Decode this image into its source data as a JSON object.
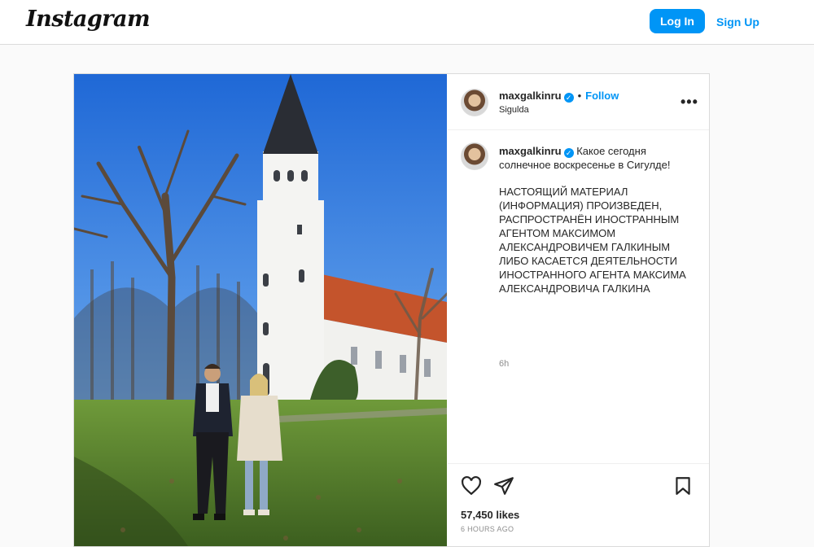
{
  "header": {
    "logo": "Instagram",
    "login_label": "Log In",
    "signup_label": "Sign Up"
  },
  "post": {
    "username": "maxgalkinru",
    "verified_mark": "✓",
    "separator": "•",
    "follow_label": "Follow",
    "location": "Sigulda",
    "more_label": "•••",
    "caption_intro": "Какое сегодня солнечное воскресенье в Сигулде!",
    "caption_body": "НАСТОЯЩИЙ МАТЕРИАЛ (ИНФОРМАЦИЯ) ПРОИЗВЕДЕН, РАСПРОСТРАНЁН ИНОСТРАННЫМ АГЕНТОМ МАКСИМОМ АЛЕКСАНДРОВИЧЕМ ГАЛКИНЫМ ЛИБО КАСАЕТСЯ ДЕЯТЕЛЬНОСТИ ИНОСТРАННОГО АГЕНТА МАКСИМА АЛЕКСАНДРОВИЧА ГАЛКИНА",
    "caption_time": "6h",
    "likes": "57,450 likes",
    "posted_ago": "6 HOURS AGO"
  },
  "icons": {
    "like": "heart-icon",
    "share": "send-icon",
    "save": "bookmark-icon",
    "verified": "verified-badge-icon",
    "more": "more-options-icon"
  },
  "colors": {
    "accent": "#0095f6",
    "border": "#dbdbdb",
    "muted": "#8e8e8e"
  }
}
